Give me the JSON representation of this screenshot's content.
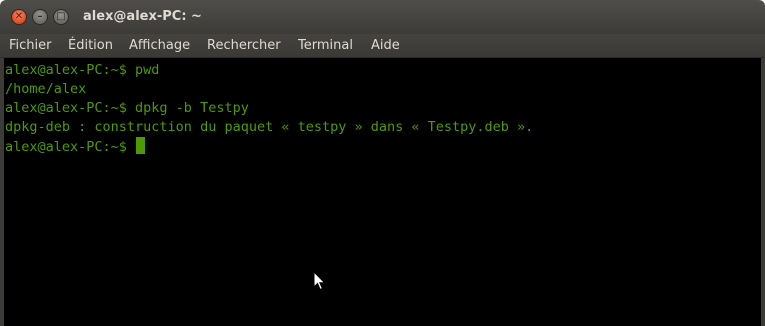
{
  "window": {
    "title": "alex@alex-PC: ~",
    "buttons": {
      "close_icon": "close-icon",
      "minimize_icon": "minimize-icon",
      "maximize_icon": "maximize-icon"
    }
  },
  "menubar": {
    "items": [
      "Fichier",
      "Édition",
      "Affichage",
      "Rechercher",
      "Terminal",
      "Aide"
    ]
  },
  "terminal": {
    "lines": [
      "alex@alex-PC:~$ pwd",
      "/home/alex",
      "alex@alex-PC:~$ dpkg -b Testpy",
      "dpkg-deb : construction du paquet « testpy » dans « Testpy.deb ».",
      "alex@alex-PC:~$ "
    ]
  },
  "colors": {
    "terminal_bg": "#000000",
    "terminal_fg": "#4e9a06",
    "titlebar": "#3c3b37",
    "close_button": "#df4a1f"
  }
}
